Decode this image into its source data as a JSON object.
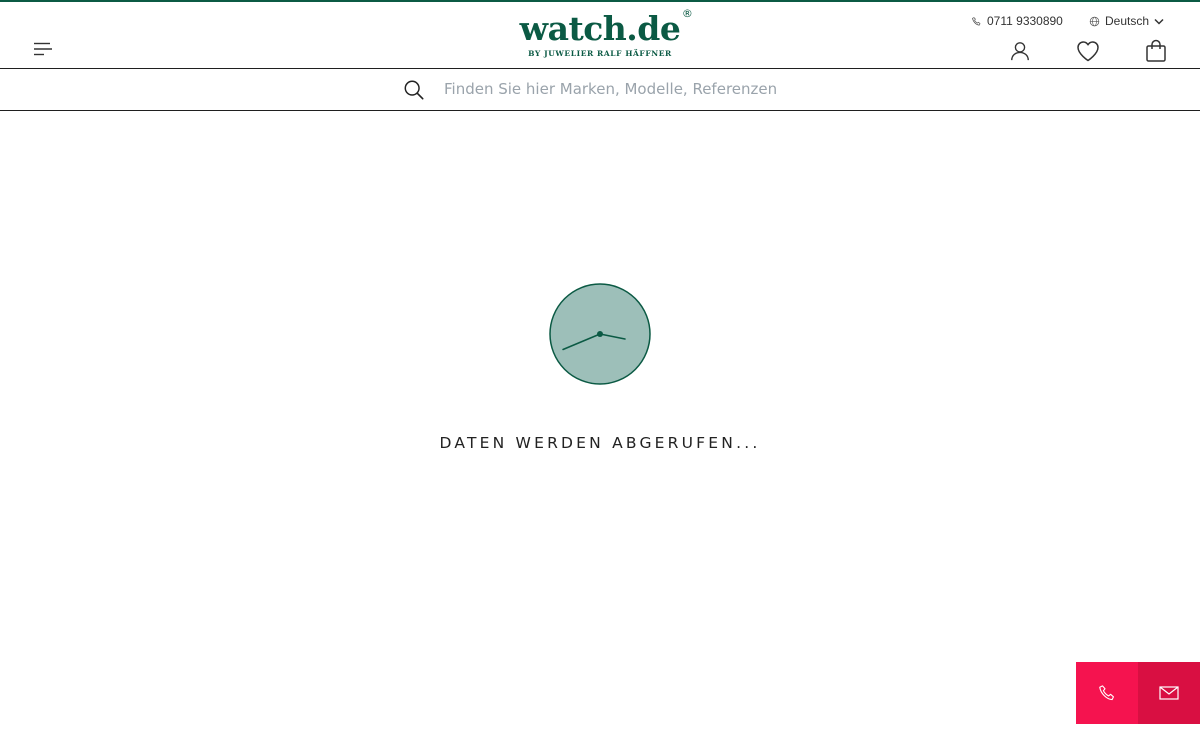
{
  "header": {
    "logo_text": "watch.de",
    "logo_registered": "®",
    "logo_subtitle": "BY JUWELIER RALF HÄFFNER",
    "phone": "0711 9330890",
    "language": "Deutsch",
    "icons": {
      "menu": "menu-icon",
      "phone": "phone-icon",
      "language": "globe-icon",
      "language_toggle": "chevron-down-icon",
      "account": "user-icon",
      "wishlist": "heart-icon",
      "cart": "shopping-bag-icon"
    }
  },
  "search": {
    "placeholder": "Finden Sie hier Marken, Modelle, Referenzen",
    "value": "",
    "icon": "search-icon"
  },
  "loading": {
    "text": "DATEN WERDEN ABGERUFEN...",
    "icon": "clock-icon"
  },
  "contact_buttons": {
    "call_icon": "phone-icon",
    "mail_icon": "mail-icon"
  },
  "colors": {
    "brand": "#0b5a44",
    "clock_face": "#9dbfb9",
    "call_button": "#f5134f",
    "mail_button": "#d90f42",
    "placeholder": "#9aa3ab"
  }
}
